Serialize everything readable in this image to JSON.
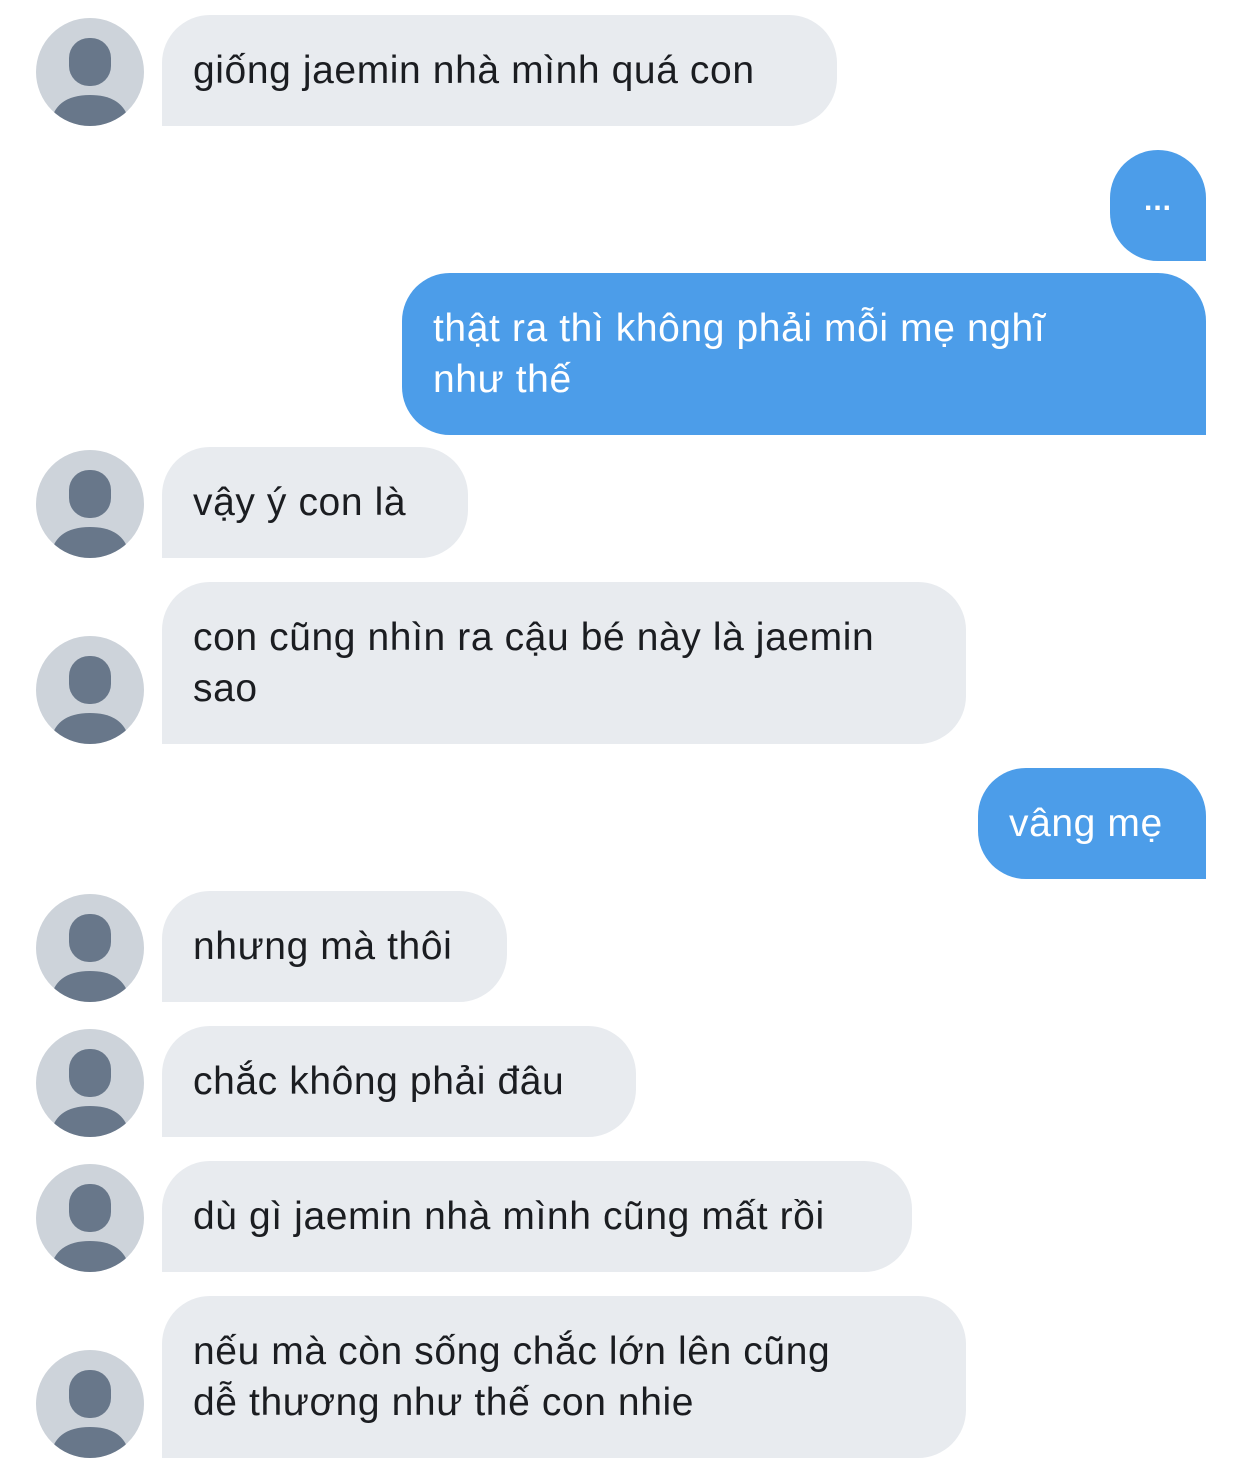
{
  "conversation": {
    "messages": [
      {
        "side": "incoming",
        "text": "giống jaemin nhà mình quá con"
      },
      {
        "side": "outgoing",
        "text": "..."
      },
      {
        "side": "outgoing",
        "text": "thật ra thì không phải mỗi mẹ nghĩ\nnhư thế"
      },
      {
        "side": "incoming",
        "text": "vậy ý con là"
      },
      {
        "side": "incoming",
        "text": "con cũng nhìn ra cậu bé này là jaemin\nsao"
      },
      {
        "side": "outgoing",
        "text": "vâng mẹ"
      },
      {
        "side": "incoming",
        "text": "nhưng mà thôi"
      },
      {
        "side": "incoming",
        "text": "chắc không phải đâu"
      },
      {
        "side": "incoming",
        "text": "dù gì jaemin nhà mình cũng mất rồi"
      },
      {
        "side": "incoming",
        "text": "nếu mà còn sống chắc lớn lên cũng\ndễ thương như thế con nhie"
      }
    ]
  },
  "colors": {
    "incoming_bubble": "#e8ebef",
    "incoming_text": "#1b1d21",
    "outgoing_bubble": "#4c9de9",
    "outgoing_text": "#ffffff",
    "avatar_background": "#cdd3da",
    "avatar_silhouette": "#68778a"
  },
  "icons": {
    "avatar": "default-user-avatar-icon"
  }
}
